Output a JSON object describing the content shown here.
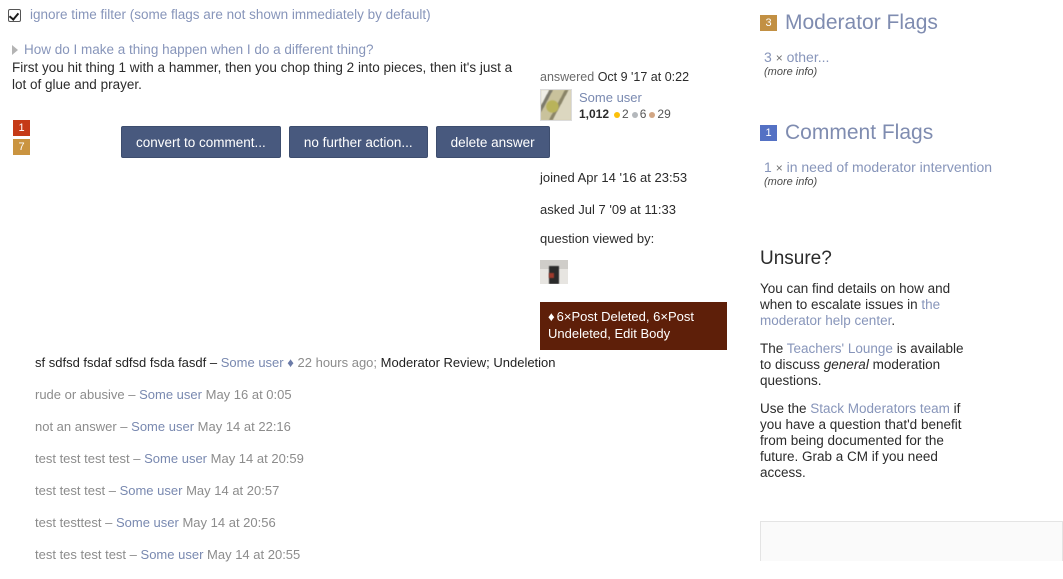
{
  "filter": {
    "checkbox_checked": true,
    "label": "ignore time filter (some flags are not shown immediately by default)"
  },
  "question": {
    "title": "How do I make a thing happen when I do a different thing?",
    "body": "First you hit thing 1 with a hammer, then you chop thing 2 into pieces, then it's just a lot of glue and prayer.",
    "vote_badges": [
      {
        "value": "1",
        "color": "#c53a17"
      },
      {
        "value": "7",
        "color": "#ca9440"
      }
    ]
  },
  "actions": {
    "convert_to_comment": "convert to comment...",
    "no_further_action": "no further action...",
    "delete_answer": "delete answer"
  },
  "post_meta": {
    "answered_prefix": "answered",
    "answered_date": "Oct 9 '17 at 0:22",
    "user_name": "Some user",
    "reputation": "1,012",
    "badges": {
      "gold": "2",
      "silver": "6",
      "bronze": "29"
    },
    "joined": "joined Apr 14 '16 at 23:53",
    "asked": "asked Jul 7 '09 at 11:33",
    "viewed_by_label": "question viewed by:",
    "post_history": "6×Post Deleted, 6×Post Undeleted, Edit Body",
    "post_history_diamond": "♦"
  },
  "comments": [
    {
      "text": "sf sdfsd fsdaf sdfsd fsda fasdf",
      "dash": "–",
      "user": "Some user",
      "diamond": "♦",
      "date": "22 hours ago;",
      "tail": "Moderator Review; Undeletion",
      "first": true
    },
    {
      "text": "rude or abusive",
      "dash": "–",
      "user": "Some user",
      "date": "May 16 at 0:05",
      "tail": "",
      "first": false
    },
    {
      "text": "not an answer",
      "dash": "–",
      "user": "Some user",
      "date": "May 14 at 22:16",
      "tail": "",
      "first": false
    },
    {
      "text": "test test test test",
      "dash": "–",
      "user": "Some user",
      "date": "May 14 at 20:59",
      "tail": "",
      "first": false
    },
    {
      "text": "test test test",
      "dash": "–",
      "user": "Some user",
      "date": "May 14 at 20:57",
      "tail": "",
      "first": false
    },
    {
      "text": "test testtest",
      "dash": "–",
      "user": "Some user",
      "date": "May 14 at 20:56",
      "tail": "",
      "first": false
    },
    {
      "text": "test tes test test",
      "dash": "–",
      "user": "Some user",
      "date": "May 14 at 20:55",
      "tail": "",
      "first": false
    }
  ],
  "sidebar": {
    "moderator_flags": {
      "count": "3",
      "count_color": "#c29043",
      "title": "Moderator Flags",
      "reason_count": "3",
      "times": "×",
      "reason": "other...",
      "more_info": "(more info)"
    },
    "comment_flags": {
      "count": "1",
      "count_color": "#5471c4",
      "title": "Comment Flags",
      "reason_count": "1",
      "times": "×",
      "reason": "in need of moderator intervention",
      "more_info": "(more info)"
    },
    "unsure": {
      "title": "Unsure?",
      "p1_before": "You can find details on how and when to escalate issues in ",
      "p1_link": "the moderator help center",
      "p1_after": ".",
      "p2_before": "The ",
      "p2_link": "Teachers' Lounge",
      "p2_mid": " is available to discuss ",
      "p2_em": "general",
      "p2_after": " moderation questions.",
      "p3_before": "Use the ",
      "p3_link": "Stack Moderators team",
      "p3_after": " if you have a question that'd benefit from being documented for the future. Grab a CM if you need access."
    },
    "bottom_panel_text": ""
  }
}
